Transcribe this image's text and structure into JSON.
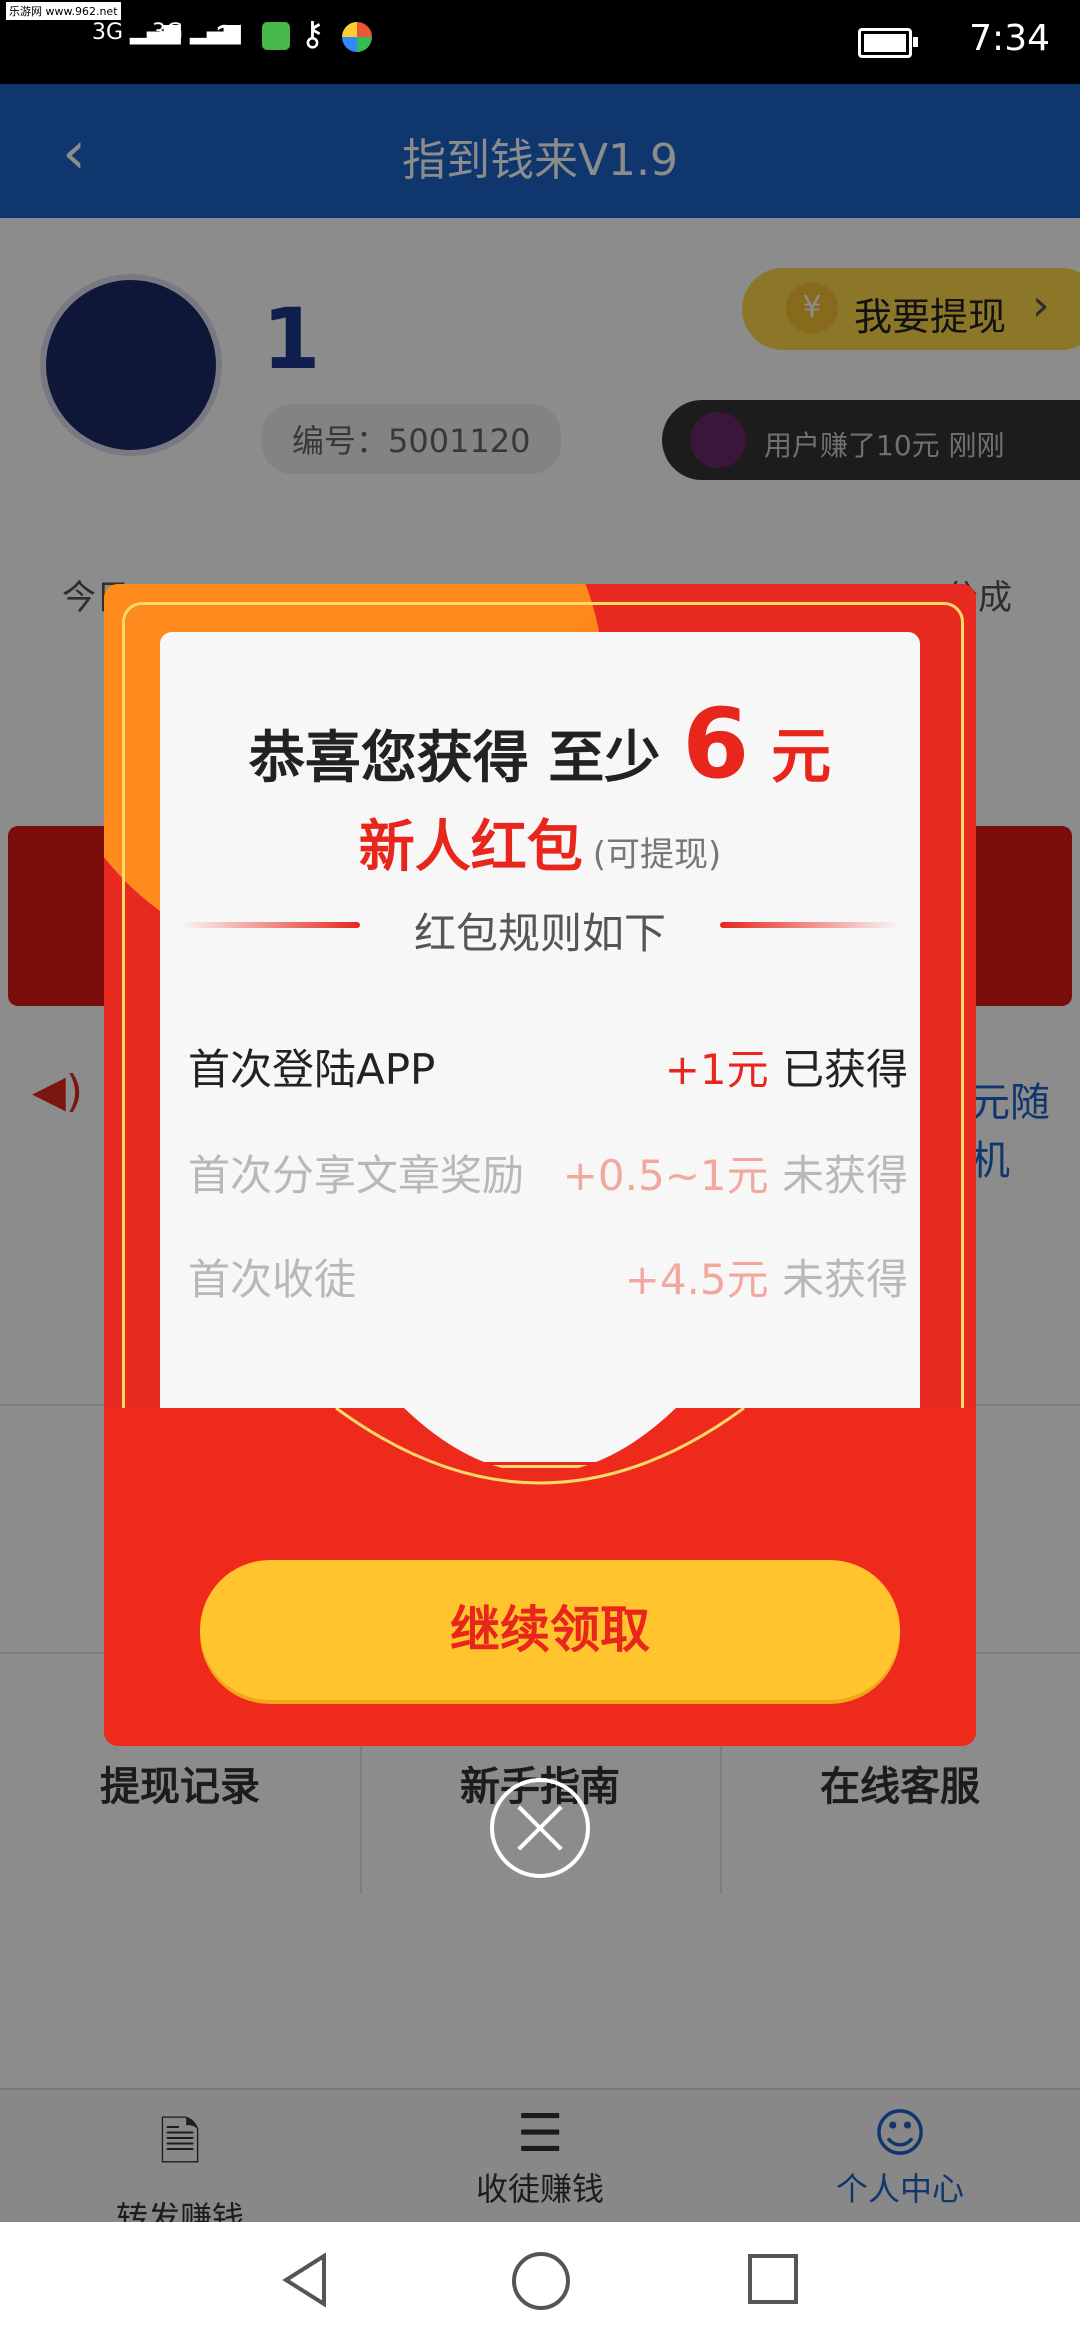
{
  "status_bar": {
    "watermark": "乐游网 www.962.net",
    "signal1": "3G",
    "signal2": "3G",
    "time": "7:34"
  },
  "header": {
    "title": "指到钱来V1.9",
    "back_icon": "chevron-left-icon"
  },
  "profile": {
    "name": "1",
    "id_label": "编号：5001120",
    "withdraw_label": "我要提现",
    "ticker_text": "用户赚了10元 刚刚"
  },
  "background": {
    "today_prefix": "今日",
    "today_suffix": "分成",
    "random_text": "元随机",
    "grid": [
      {
        "label": "提现记录",
        "icon": "ledger-icon"
      },
      {
        "label": "新手指南",
        "icon": "question-icon"
      },
      {
        "label": "在线客服",
        "icon": "headset-icon"
      }
    ]
  },
  "tabbar": {
    "tabs": [
      {
        "label": "转发赚钱",
        "icon": "document-yen-icon",
        "active": false
      },
      {
        "label": "收徒赚钱",
        "icon": "coins-stack-icon",
        "active": false
      },
      {
        "label": "个人中心",
        "icon": "user-icon",
        "active": true
      }
    ]
  },
  "modal": {
    "headline_prefix": "恭喜您获得 至少",
    "amount": "6",
    "unit": "元",
    "subhead": "新人红包",
    "subhead_note": "(可提现)",
    "rules_title": "红包规则如下",
    "rules": [
      {
        "label": "首次登陆APP",
        "amount": "+1元",
        "status": "已获得",
        "done": true
      },
      {
        "label": "首次分享文章奖励",
        "amount": "+0.5~1元",
        "status": "未获得",
        "done": false
      },
      {
        "label": "首次收徒",
        "amount": "+4.5元",
        "status": "未获得",
        "done": false
      }
    ],
    "claim_button": "继续领取"
  },
  "colors": {
    "brand_blue": "#1c64c8",
    "modal_red": "#e8291f",
    "button_yellow": "#ffc42e"
  }
}
